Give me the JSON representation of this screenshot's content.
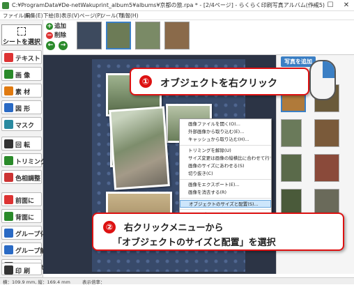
{
  "window": {
    "title": "C:¥ProgramData¥De-netWakuprint_album5¥albums¥京都の旅.rpa * - [2/4ページ] - らくらく印刷写真アルバム(作成5)",
    "min": "—",
    "max": "☐",
    "close": "✕"
  },
  "menu": [
    "ファイル(F)",
    "編集(E)",
    "下絵(B)",
    "表示(V)",
    "ページ(P)",
    "ツール(T)",
    "情報(H)"
  ],
  "tools": {
    "select_label": "シートを選択",
    "items": [
      {
        "label": "テキスト",
        "icon": "text-icon",
        "color": "#d33"
      },
      {
        "label": "画 像",
        "icon": "image-icon",
        "color": "#2a8a2a"
      },
      {
        "label": "素 材",
        "icon": "star-icon",
        "color": "#e07a10"
      },
      {
        "label": "図 形",
        "icon": "shape-icon",
        "color": "#2a6ac4"
      },
      {
        "label": "マスク",
        "icon": "mask-icon",
        "color": "#2a8aa0"
      },
      {
        "label": "回 転",
        "icon": "rotate-icon",
        "color": "#333"
      },
      {
        "label": "トリミング",
        "icon": "trim-icon",
        "color": "#2a8a2a"
      },
      {
        "label": "色相調整",
        "icon": "color-adjust-icon",
        "color": "#c33"
      },
      {
        "label": "前面に",
        "icon": "bring-front-icon",
        "color": "#d33"
      },
      {
        "label": "背面に",
        "icon": "send-back-icon",
        "color": "#2a8a2a"
      },
      {
        "label": "グループ化",
        "icon": "group-icon",
        "color": "#2a6ac4"
      },
      {
        "label": "グループ解除",
        "icon": "ungroup-icon",
        "color": "#2a6ac4"
      },
      {
        "label": "位置合わせ",
        "icon": "align-icon",
        "color": "#333"
      },
      {
        "label": "印 刷",
        "icon": "printer-icon",
        "color": "#333"
      }
    ]
  },
  "strip": {
    "add": "追加",
    "delete": "削除"
  },
  "panel": {
    "add_photo": "写真を追加"
  },
  "callout1": {
    "num": "①",
    "text": "オブジェクトを右クリック"
  },
  "callout2": {
    "num": "②",
    "line1": "右クリックメニューから",
    "line2": "「オブジェクトのサイズと配置」を選択"
  },
  "context_menu": [
    "画像ファイルを開く(O)...",
    "外部画像から取り込む(E)...",
    "キャッシュから取り込む(H)...",
    "",
    "トリミングを解除(U)",
    "サイズ変更は画像の縦横比に合わせて行う(A)",
    "画像のサイズにあわせる(S)",
    "切り抜き(C)",
    "",
    "画像をエクスポート(E)...",
    "画像を消去する(R)",
    "",
    "オブジェクトのサイズと配置(S)...",
    "",
    "ドロップシャドウ...",
    "ふちぼかし..."
  ],
  "status": {
    "size": "横：109.9 mm, 縦：169.4 mm",
    "zoom": "表示倍率："
  }
}
